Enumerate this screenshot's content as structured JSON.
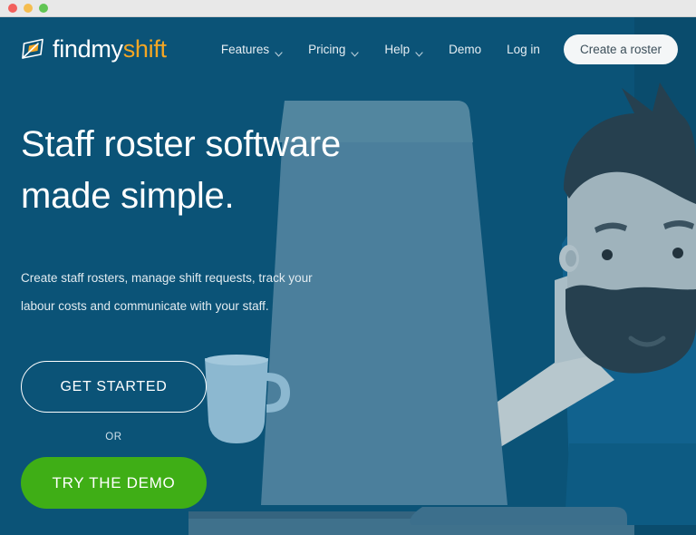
{
  "window": {
    "traffic_lights": [
      "close",
      "minimize",
      "maximize"
    ]
  },
  "brand": {
    "name_part1": "findmy",
    "name_part2": "shift",
    "logo_icon": "leaf-page-icon",
    "color_white": "#ffffff",
    "color_orange": "#f5a623"
  },
  "nav": {
    "items": [
      {
        "label": "Features",
        "has_dropdown": true
      },
      {
        "label": "Pricing",
        "has_dropdown": true
      },
      {
        "label": "Help",
        "has_dropdown": true
      },
      {
        "label": "Demo",
        "has_dropdown": false
      },
      {
        "label": "Log in",
        "has_dropdown": false
      }
    ],
    "cta_label": "Create a roster"
  },
  "hero": {
    "headline_line1": "Staff roster software",
    "headline_line2": "made simple.",
    "subhead_line1": "Create staff rosters, manage shift requests, track your",
    "subhead_line2": "labour costs and communicate with your staff.",
    "primary_button": "GET STARTED",
    "divider_label": "OR",
    "secondary_button": "TRY THE DEMO"
  },
  "theme": {
    "background": "#0b5377",
    "green_button": "#3fae16",
    "cta_pill_bg": "#f4f6f7",
    "cta_pill_text": "#3c4f5a",
    "titlebar_bg": "#e8e8e8"
  },
  "illustration": {
    "description": "flat-illustration-man-at-laptop",
    "elements": [
      "bearded-man",
      "laptop",
      "coffee-mug",
      "desk"
    ]
  }
}
